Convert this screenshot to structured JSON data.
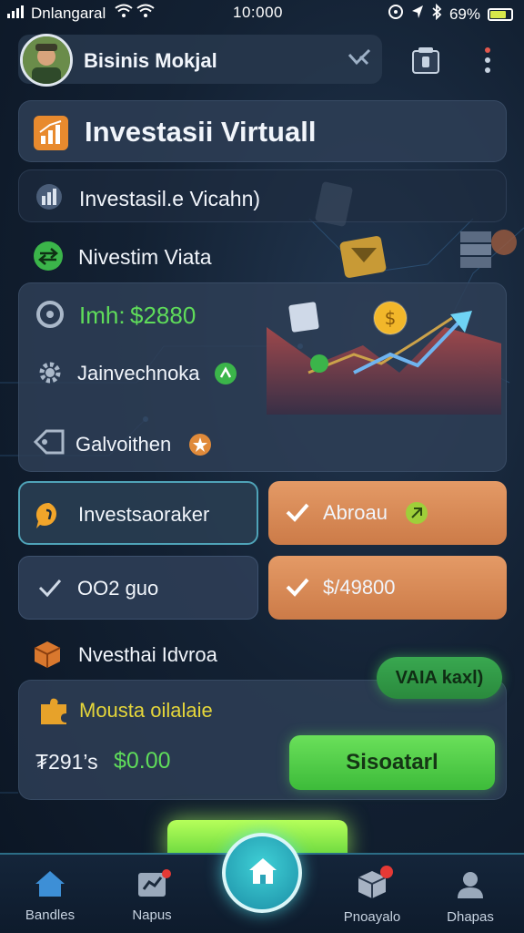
{
  "status_bar": {
    "carrier": "Dnlangaral",
    "time": "10:000",
    "battery": "69%",
    "battery_level": 0.69
  },
  "header": {
    "user_name": "Bisinis Mokjal"
  },
  "title_card": {
    "title": "Investasii Virtuall"
  },
  "rows": [
    {
      "label": "Investasil.e Vicahn)"
    },
    {
      "label": "Nivestim Viata"
    }
  ],
  "stats": {
    "line1_label": "Imh:",
    "line1_value": "$2880",
    "line2_label": "Jainvechnoka",
    "line3_label": "Galvoithen"
  },
  "buttons": [
    {
      "label": "Investsaoraker"
    },
    {
      "label": "Abroau"
    },
    {
      "label": "OO2 guo"
    },
    {
      "label": "$/49800"
    }
  ],
  "section": {
    "title": "Nvesthai Idvroa"
  },
  "promo": {
    "pill": "VAIA kaxl)",
    "title": "Mousta oilalaie",
    "amount_prefix": "₮291’s",
    "amount": "$0.00",
    "action": "Sisoatarl"
  },
  "nav": [
    {
      "label": "Bandles"
    },
    {
      "label": "Napus"
    },
    {
      "label": "Pnoayalo"
    },
    {
      "label": "Dhapas"
    }
  ],
  "colors": {
    "accent_green": "#3dbb3a",
    "accent_orange": "#d98a55",
    "nav_accent": "#2c6d86"
  }
}
